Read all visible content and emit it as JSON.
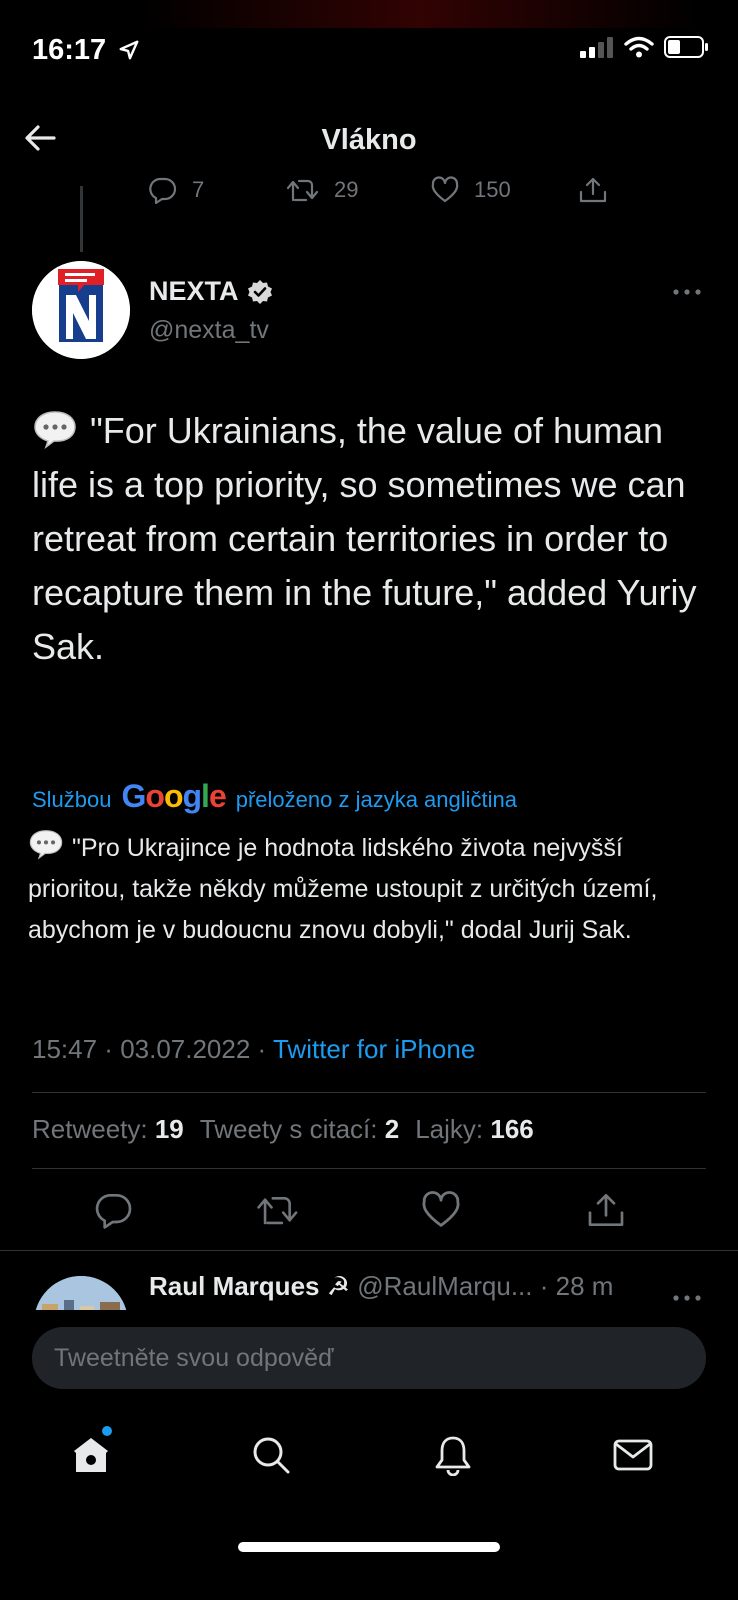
{
  "status_bar": {
    "time": "16:17"
  },
  "header": {
    "title": "Vlákno"
  },
  "previous_tweet": {
    "replies": "7",
    "retweets": "29",
    "likes": "150"
  },
  "tweet": {
    "author_name": "NEXTA",
    "author_handle": "@nexta_tv",
    "text": "\"For Ukrainians, the value of human life is a top priority, so sometimes we can retreat from certain territories in order to recapture them in the future,\" added Yuriy Sak.",
    "translation_prefix": "Službou",
    "translation_brand": "Google",
    "translation_suffix": "přeloženo z jazyka angličtina",
    "translated_text": "\"Pro Ukrajince je hodnota lidského života nejvyšší prioritou, takže někdy můžeme ustoupit z určitých území, abychom je v budoucnu znovu dobyli,\" dodal Jurij Sak.",
    "time": "15:47",
    "date": "03.07.2022",
    "source": "Twitter for iPhone",
    "stats": {
      "retweets_label": "Retweety:",
      "retweets": "19",
      "quotes_label": "Tweety s citací:",
      "quotes": "2",
      "likes_label": "Lajky:",
      "likes": "166"
    }
  },
  "reply": {
    "name": "Raul Marques ☭",
    "handle": "@RaulMarqu...",
    "time": "28 m"
  },
  "compose": {
    "placeholder": "Tweetněte svou odpověď"
  },
  "colors": {
    "accent": "#1d9bf0",
    "muted": "#71767b",
    "background": "#000000"
  },
  "icons": [
    "back-arrow-icon",
    "reply-icon",
    "retweet-icon",
    "like-icon",
    "share-icon",
    "verified-icon",
    "more-icon",
    "home-icon",
    "search-icon",
    "notifications-icon",
    "messages-icon"
  ]
}
